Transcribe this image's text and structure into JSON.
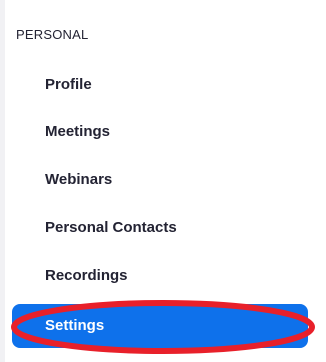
{
  "sidebar": {
    "section_heading": "PERSONAL",
    "items": [
      {
        "label": "Profile"
      },
      {
        "label": "Meetings"
      },
      {
        "label": "Webinars"
      },
      {
        "label": "Personal Contacts"
      },
      {
        "label": "Recordings"
      },
      {
        "label": "Settings",
        "active": true
      }
    ],
    "accent_color": "#0e71eb",
    "annotation_color": "#e8202a"
  }
}
